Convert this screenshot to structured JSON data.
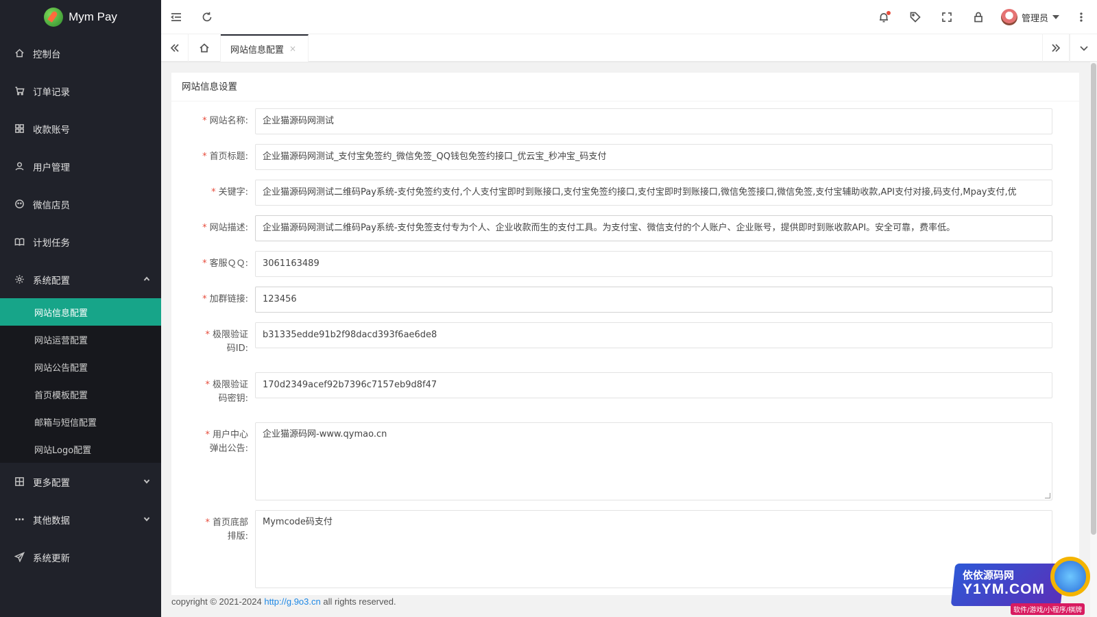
{
  "app": {
    "title": "Mym Pay"
  },
  "sidebar": {
    "items": [
      {
        "label": "控制台",
        "icon": "home-icon"
      },
      {
        "label": "订单记录",
        "icon": "cart-icon"
      },
      {
        "label": "收款账号",
        "icon": "apps-icon"
      },
      {
        "label": "用户管理",
        "icon": "user-icon"
      },
      {
        "label": "微信店员",
        "icon": "wechat-icon"
      },
      {
        "label": "计划任务",
        "icon": "book-icon"
      },
      {
        "label": "系统配置",
        "icon": "gear-icon",
        "expanded": true
      }
    ],
    "submenu": [
      {
        "label": "网站信息配置",
        "active": true
      },
      {
        "label": "网站运营配置"
      },
      {
        "label": "网站公告配置"
      },
      {
        "label": "首页模板配置"
      },
      {
        "label": "邮箱与短信配置"
      },
      {
        "label": "网站Logo配置"
      }
    ],
    "bottom_items": [
      {
        "label": "更多配置",
        "icon": "grid-icon"
      },
      {
        "label": "其他数据",
        "icon": "more-dots-icon"
      },
      {
        "label": "系统更新",
        "icon": "send-icon"
      }
    ]
  },
  "header": {
    "username": "管理员"
  },
  "tabs": {
    "active_tab": "网站信息配置",
    "close_glyph": "×"
  },
  "card": {
    "title": "网站信息设置"
  },
  "form": {
    "required_mark": "*",
    "site_name": {
      "label": "网站名称:",
      "value": "企业猫源码网测试"
    },
    "home_title": {
      "label": "首页标题:",
      "value": "企业猫源码网测试_支付宝免签约_微信免签_QQ钱包免签约接口_优云宝_秒冲宝_码支付"
    },
    "keywords": {
      "label": "关键字:",
      "value": "企业猫源码网测试二维码Pay系统-支付免签约支付,个人支付宝即时到账接口,支付宝免签约接口,支付宝即时到账接口,微信免签接口,微信免签,支付宝辅助收款,API支付对接,码支付,Mpay支付,优"
    },
    "description": {
      "label": "网站描述:",
      "value": "企业猫源码网测试二维码Pay系统-支付免签支付专为个人、企业收款而生的支付工具。为支付宝、微信支付的个人账户、企业账号，提供即时到账收款API。安全可靠，费率低。"
    },
    "service_qq": {
      "label": "客服ＱＱ:",
      "value": "3061163489"
    },
    "group_link": {
      "label": "加群链接:",
      "value": "123456"
    },
    "captcha_id": {
      "label_1": "极限验证",
      "label_2": "码ID:",
      "value": "b31335edde91b2f98dacd393f6ae6de8"
    },
    "captcha_key": {
      "label_1": "极限验证",
      "label_2": "码密钥:",
      "value": "170d2349acef92b7396c7157eb9d8f47"
    },
    "user_notice": {
      "label_1": "用户中心",
      "label_2": "弹出公告:",
      "value": "企业猫源码网-www.qymao.cn"
    },
    "footer_layout": {
      "label_1": "首页底部",
      "label_2": "排版:",
      "value": "Mymcode码支付"
    }
  },
  "footer": {
    "prefix": "copyright © 2021-2024 ",
    "link": "http://g.9o3.cn",
    "suffix": " all rights reserved."
  },
  "watermark": {
    "cn": "依依源码网",
    "en": "Y1YM.COM",
    "tag": "软件/游戏/小程序/棋牌"
  },
  "colors": {
    "sidebar_bg": "#20222a",
    "active_green": "#17a589",
    "required_red": "#e74c3c",
    "link_blue": "#1e88e5"
  }
}
